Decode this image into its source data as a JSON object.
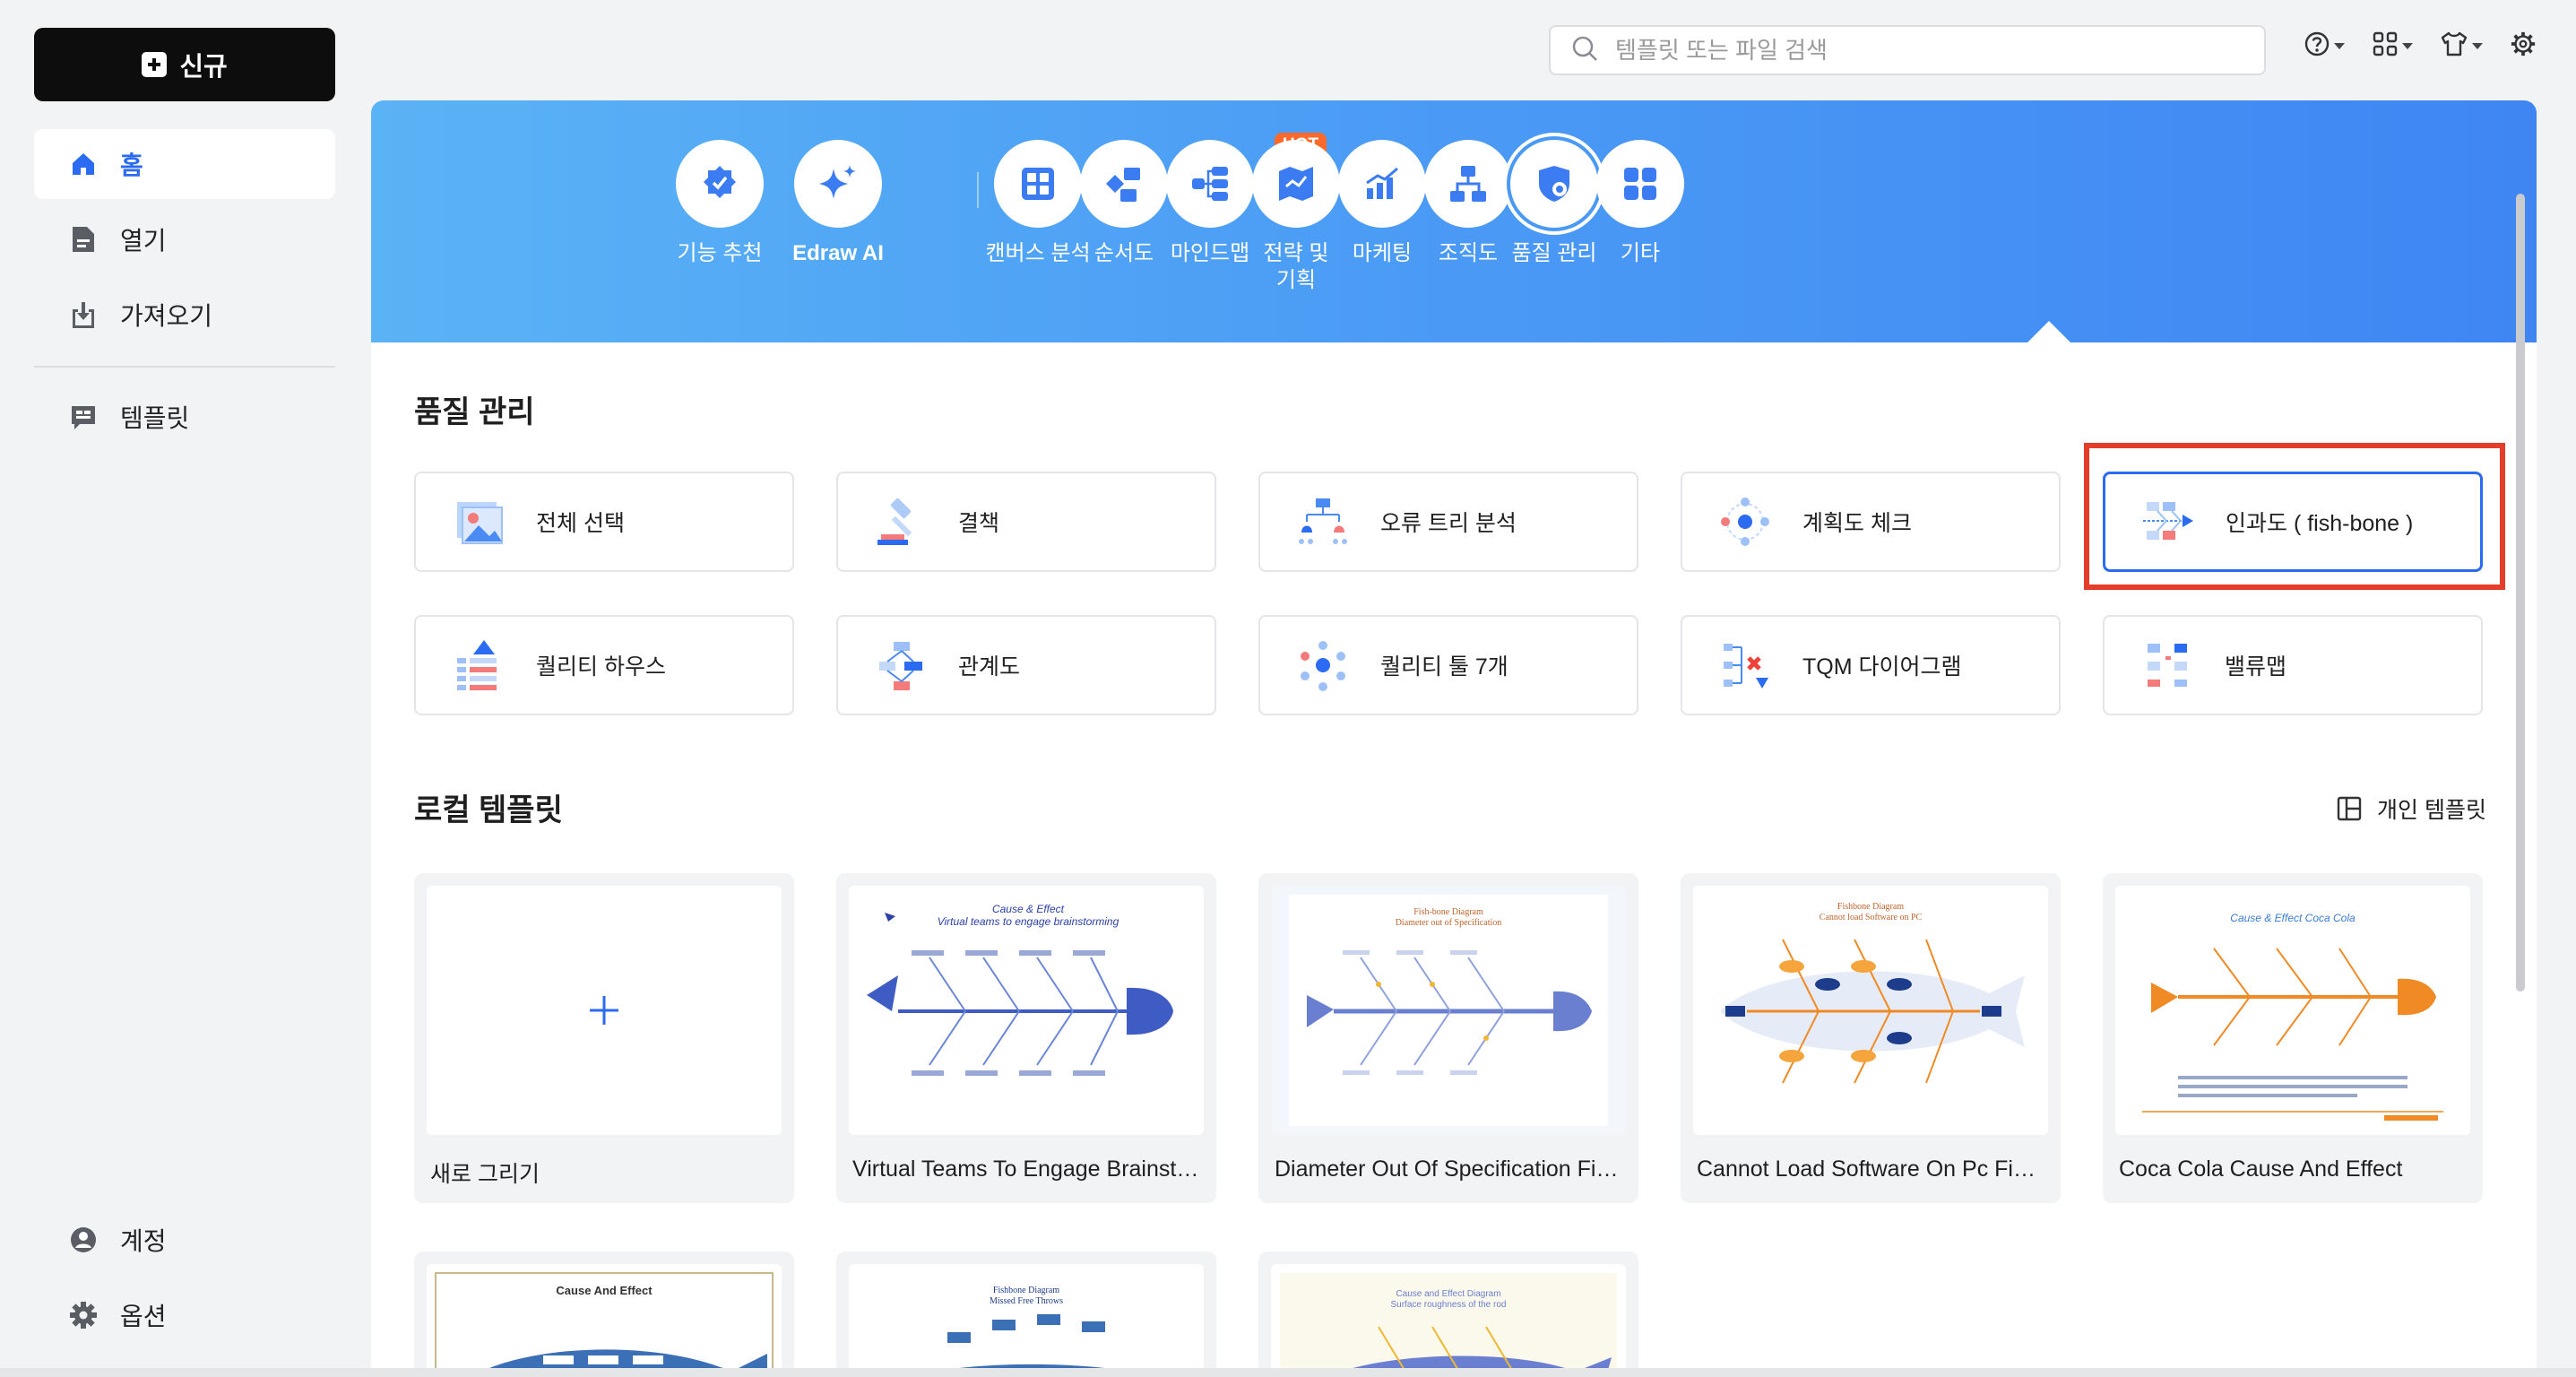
{
  "sidebar": {
    "new_label": "신규",
    "nav": [
      {
        "label": "홈",
        "icon": "home-icon"
      },
      {
        "label": "열기",
        "icon": "file-icon"
      },
      {
        "label": "가져오기",
        "icon": "import-icon"
      }
    ],
    "template_label": "템플릿",
    "account_label": "계정",
    "options_label": "옵션"
  },
  "topbar": {
    "search_placeholder": "템플릿 또는 파일 검색"
  },
  "categories": [
    {
      "label": "기능 추천"
    },
    {
      "label": "Edraw AI",
      "badge": "HOT"
    },
    {
      "label": "캔버스 분석"
    },
    {
      "label": "순서도"
    },
    {
      "label": "마인드맵"
    },
    {
      "label": "전략 및 기획"
    },
    {
      "label": "마케팅"
    },
    {
      "label": "조직도"
    },
    {
      "label": "품질 관리",
      "selected": true
    },
    {
      "label": "기타"
    }
  ],
  "quality": {
    "title": "품질 관리",
    "tiles": [
      {
        "label": "전체 선택"
      },
      {
        "label": "결책"
      },
      {
        "label": "오류 트리 분석"
      },
      {
        "label": "계획도 체크"
      },
      {
        "label": "인과도 ( fish-bone )"
      },
      {
        "label": "퀄리티 하우스"
      },
      {
        "label": "관계도"
      },
      {
        "label": "퀄리티 툴 7개"
      },
      {
        "label": "TQM 다이어그램"
      },
      {
        "label": "밸류맵"
      }
    ]
  },
  "local": {
    "title": "로컬 템플릿",
    "personal_label": "개인 템플릿",
    "new_card_label": "새로 그리기",
    "cards": [
      {
        "title": "Virtual Teams To Engage Brainstorming",
        "thumb_title": "Cause & Effect",
        "thumb_subtitle": "Virtual teams to engage brainstorming"
      },
      {
        "title": "Diameter Out Of Specification Fishbone",
        "thumb_title": "Fish-bone Diagram",
        "thumb_subtitle": "Diameter out of Specification"
      },
      {
        "title": "Cannot Load Software On Pc Fishbone",
        "thumb_title": "Fishbone Diagram",
        "thumb_subtitle": "Cannot load Software on PC"
      },
      {
        "title": "Coca Cola Cause And Effect",
        "thumb_title": "Cause & Effect Coca Cola"
      }
    ],
    "partial_cards": [
      {
        "thumb_title": "Cause And Effect"
      },
      {
        "thumb_title": "Fishbone Diagram",
        "thumb_subtitle": "Missed Free Throws"
      },
      {
        "thumb_title": "Cause and Effect Diagram",
        "thumb_subtitle": "Surface roughness of the rod"
      }
    ]
  },
  "colors": {
    "accent": "#2a6bf2",
    "highlight_frame": "#e43d2a",
    "hot": "#ff6a2c"
  }
}
